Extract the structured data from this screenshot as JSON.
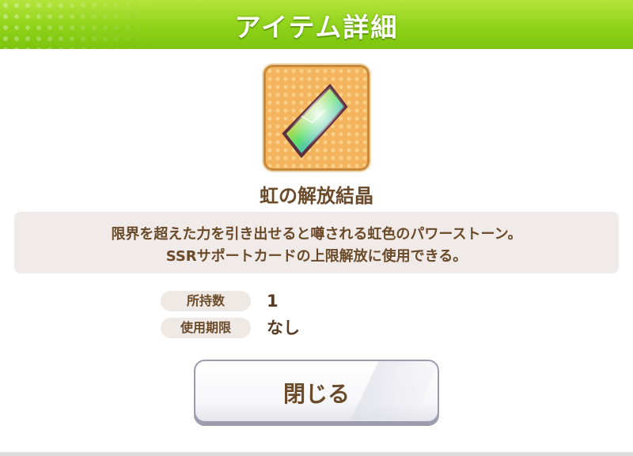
{
  "dialog": {
    "title": "アイテム詳細",
    "item_icon": "rainbow-crystal-icon",
    "item_name": "虹の解放結晶",
    "description_lines": [
      "限界を超えた力を引き出せると噂される虹色のパワーストーン。",
      "SSRサポートカードの上限解放に使用できる。"
    ],
    "info": [
      {
        "label": "所持数",
        "value": "1"
      },
      {
        "label": "使用期限",
        "value": "なし"
      }
    ],
    "close_label": "閉じる"
  },
  "colors": {
    "header_green": "#8fd21a",
    "text_brown": "#6b4a2a",
    "icon_bg_orange": "#f4b45e",
    "description_bg": "#f0ebe8"
  }
}
